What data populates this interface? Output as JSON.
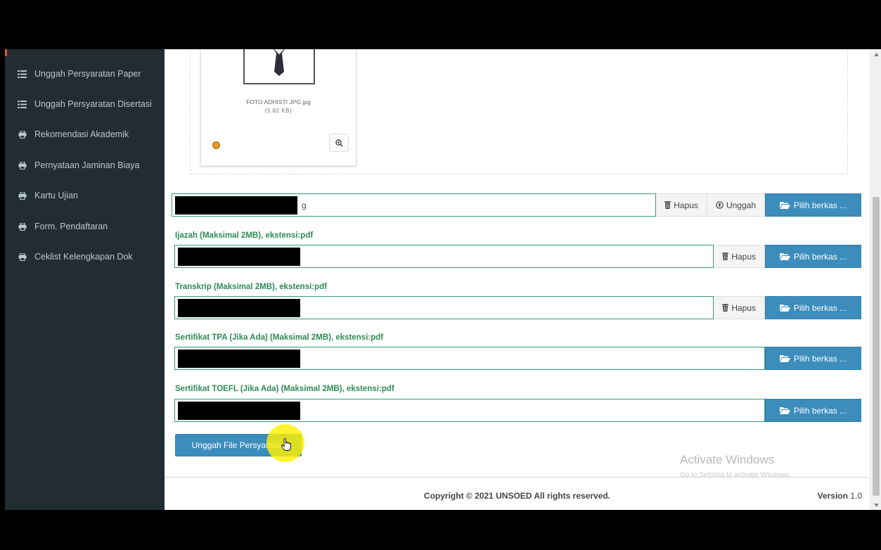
{
  "sidebar": {
    "items": [
      {
        "label": "Unggah Persyaratan Paper",
        "icon": "list-icon"
      },
      {
        "label": "Unggah Persyaratan Disertasi",
        "icon": "list-icon"
      },
      {
        "label": "Rekomendasi Akademik",
        "icon": "print-icon"
      },
      {
        "label": "Pernyataan Jaminan Biaya",
        "icon": "print-icon"
      },
      {
        "label": "Kartu Ujian",
        "icon": "print-icon"
      },
      {
        "label": "Form. Pendaftaran",
        "icon": "print-icon"
      },
      {
        "label": "Ceklist Kelengkapan Dok",
        "icon": "print-icon"
      }
    ]
  },
  "preview": {
    "file_name": "FOTO ADHISTI JPG.jpg",
    "file_size": "(5.82 KB)"
  },
  "photo_field": {
    "value_suffix": "g",
    "hapus": "Hapus",
    "unggah": "Unggah",
    "pilih": "Pilih berkas ..."
  },
  "fields": [
    {
      "label": "Ijazah (Maksimal 2MB), ekstensi:pdf",
      "hapus": "Hapus",
      "pilih": "Pilih berkas ..."
    },
    {
      "label": "Transkrip (Maksimal 2MB), ekstensi:pdf",
      "hapus": "Hapus",
      "pilih": "Pilih berkas ..."
    },
    {
      "label": "Sertifikat TPA (Jika Ada) (Maksimal 2MB), ekstensi:pdf",
      "pilih": "Pilih berkas ..."
    },
    {
      "label": "Sertifikat TOEFL (Jika Ada) (Maksimal 2MB), ekstensi:pdf",
      "pilih": "Pilih berkas ..."
    }
  ],
  "submit": {
    "label": "Unggah File Persyaratan"
  },
  "footer": {
    "copyright": "Copyright © 2021 UNSOED All rights reserved.",
    "version_label": "Version",
    "version_value": "1.0"
  },
  "watermark": {
    "title": "Activate Windows",
    "subtitle": "Go to Settings to activate Windows."
  },
  "colors": {
    "sidebar_bg": "#222d32",
    "primary": "#3c8dbc",
    "label_green": "#2e8b57"
  }
}
